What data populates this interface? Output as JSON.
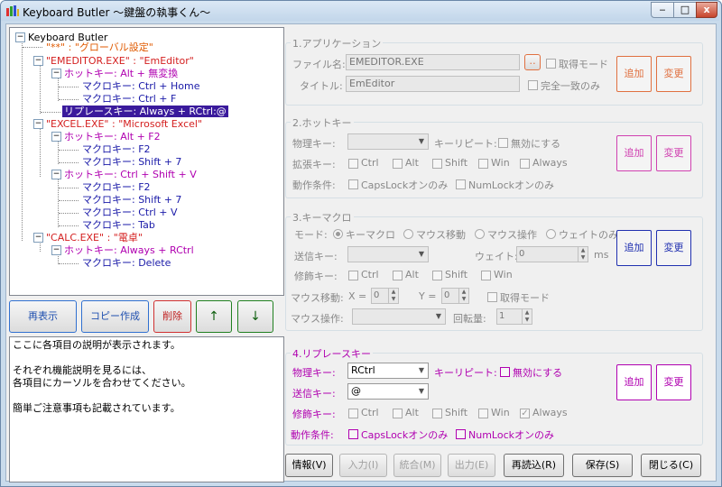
{
  "window": {
    "title": "Keyboard Butler ～鍵盤の執事くん～",
    "min": "‒",
    "max": "□",
    "close": "x"
  },
  "tree": {
    "root": "Keyboard Butler",
    "global": "\"**\" : \"グローバル設定\"",
    "emeditor": "\"EMEDITOR.EXE\" : \"EmEditor\"",
    "em_hk1": "ホットキー: Alt + 無変換",
    "em_mk1": "マクロキー: Ctrl + Home",
    "em_mk2": "マクロキー: Ctrl + F",
    "em_rep": "リプレースキー: Always + RCtrl:@",
    "excel": "\"EXCEL.EXE\" : \"Microsoft Excel\"",
    "ex_hk1": "ホットキー: Alt + F2",
    "ex_mk1": "マクロキー: F2",
    "ex_mk2": "マクロキー: Shift + 7",
    "ex_hk2": "ホットキー: Ctrl + Shift + V",
    "ex_mk3": "マクロキー: F2",
    "ex_mk4": "マクロキー: Shift + 7",
    "ex_mk5": "マクロキー: Ctrl + V",
    "ex_mk6": "マクロキー: Tab",
    "calc": "\"CALC.EXE\" : \"電卓\"",
    "ca_hk1": "ホットキー: Always + RCtrl",
    "ca_mk1": "マクロキー: Delete"
  },
  "tree_buttons": {
    "refresh": "再表示",
    "copy": "コピー作成",
    "delete": "削除",
    "up": "↑",
    "down": "↓"
  },
  "description": [
    "ここに各項目の説明が表示されます。",
    "",
    "それぞれ機能説明を見るには、",
    "各項目にカーソルを合わせてください。",
    "",
    "簡単ご注意事項も記載されています。"
  ],
  "app": {
    "group_title": "1.アプリケーション",
    "file_label": "ファイル名:",
    "file_value": "EMEDITOR.EXE",
    "pick_button": "‥",
    "get_mode": "取得モード",
    "title_label": "タイトル:",
    "title_value": "EmEditor",
    "exact_match": "完全一致のみ",
    "add": "追加",
    "change": "変更"
  },
  "hotkey": {
    "group_title": "2.ホットキー",
    "phys_label": "物理キー:",
    "phys_value": "",
    "repeat_label": "キーリピート:",
    "repeat_disable": "無効にする",
    "ext_label": "拡張キー:",
    "mods": [
      "Ctrl",
      "Alt",
      "Shift",
      "Win",
      "Always"
    ],
    "cond_label": "動作条件:",
    "caps": "CapsLockオンのみ",
    "num": "NumLockオンのみ",
    "add": "追加",
    "change": "変更"
  },
  "macro": {
    "group_title": "3.キーマクロ",
    "mode_label": "モード:",
    "modes": [
      "キーマクロ",
      "マウス移動",
      "マウス操作",
      "ウェイトのみ"
    ],
    "send_label": "送信キー:",
    "send_value": "",
    "wait_label": "ウェイト:",
    "wait_value": "0",
    "wait_unit": "ms",
    "mod_label": "修飾キー:",
    "mods": [
      "Ctrl",
      "Alt",
      "Shift",
      "Win"
    ],
    "move_label": "マウス移動:",
    "x_label": "X =",
    "x_value": "0",
    "y_label": "Y =",
    "y_value": "0",
    "get_mode": "取得モード",
    "op_label": "マウス操作:",
    "op_value": "",
    "rot_label": "回転量:",
    "rot_value": "1",
    "add": "追加",
    "change": "変更"
  },
  "replace": {
    "group_title": "4.リプレースキー",
    "phys_label": "物理キー:",
    "phys_value": "RCtrl",
    "repeat_label": "キーリピート:",
    "repeat_disable": "無効にする",
    "send_label": "送信キー:",
    "send_value": "@",
    "mod_label": "修飾キー:",
    "mods": [
      "Ctrl",
      "Alt",
      "Shift",
      "Win",
      "Always"
    ],
    "always_checked": "✓",
    "cond_label": "動作条件:",
    "caps": "CapsLockオンのみ",
    "num": "NumLockオンのみ",
    "add": "追加",
    "change": "変更"
  },
  "bottom": {
    "info": "情報(V)",
    "input": "入力(I)",
    "merge": "統合(M)",
    "output": "出力(E)",
    "reload": "再読込(R)",
    "save": "保存(S)",
    "close": "閉じる(C)"
  },
  "colors": {
    "app": "#e07040",
    "hotkey": "#d040b0",
    "macro": "#2030b0",
    "replace": "#b000b0",
    "delete": "#d03030",
    "arrows": "#208020",
    "blue_btn": "#3070d0"
  }
}
